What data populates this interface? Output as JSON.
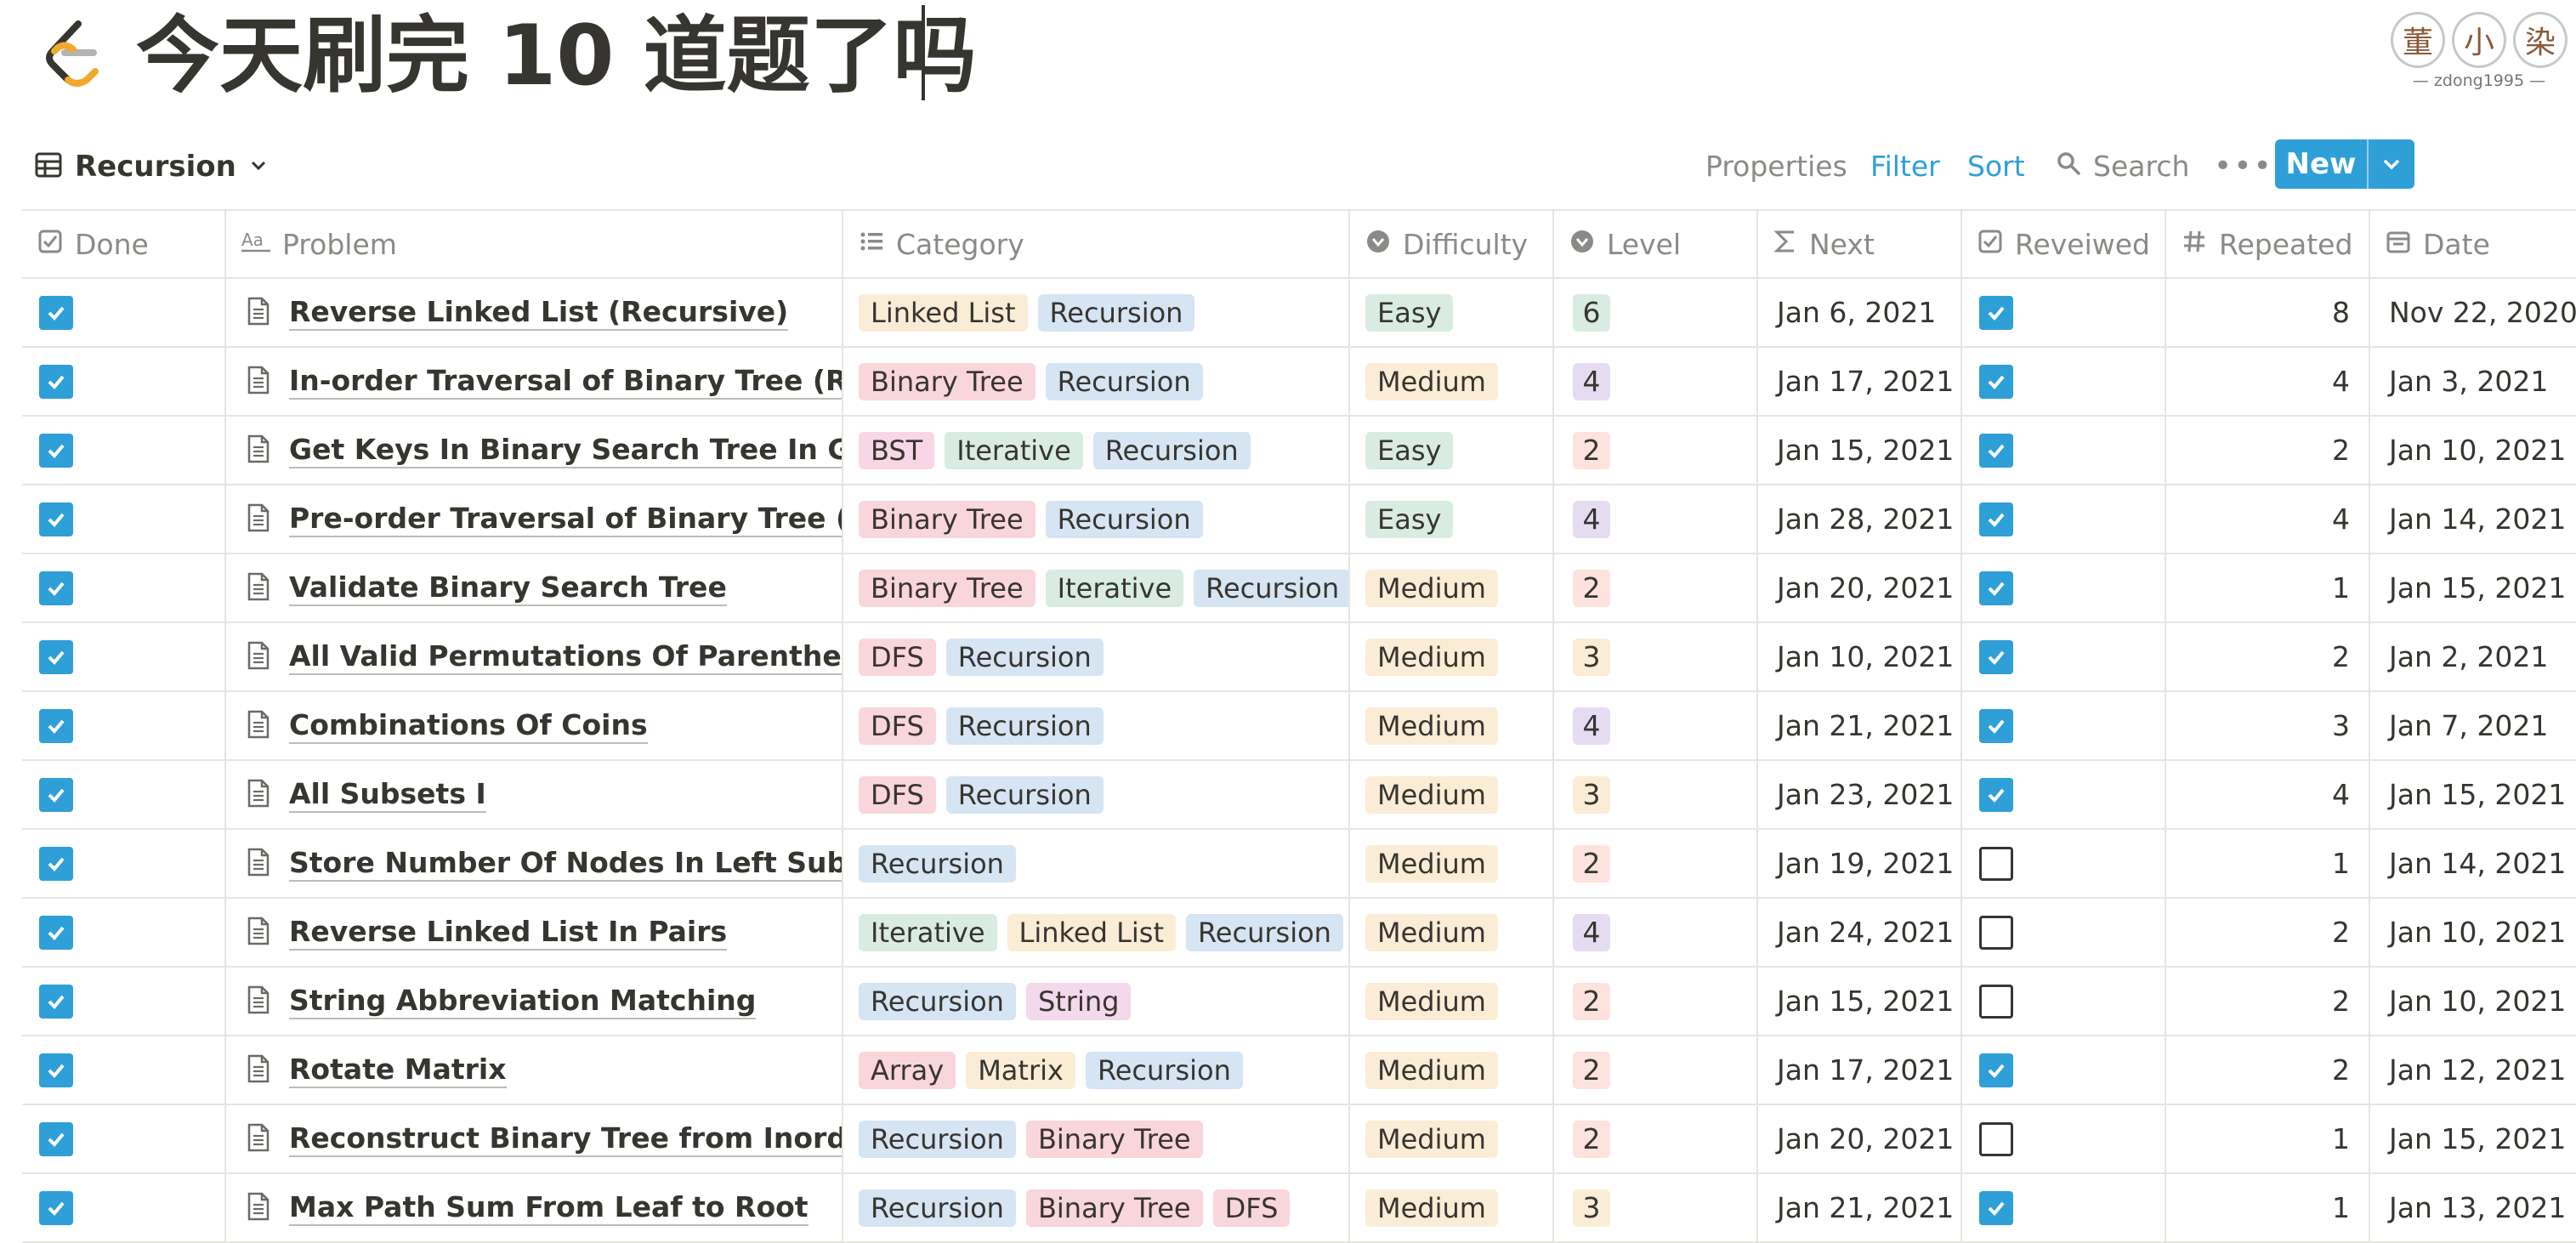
{
  "page": {
    "title": "今天刷完 10 道题了吗"
  },
  "watermark": {
    "stamps": [
      "董",
      "小",
      "染"
    ],
    "caption": "— zdong1995 —"
  },
  "toolbar": {
    "view_name": "Recursion",
    "properties": "Properties",
    "filter": "Filter",
    "sort": "Sort",
    "search": "Search",
    "more": "•••",
    "new_label": "New"
  },
  "columns": [
    "Done",
    "Problem",
    "Category",
    "Difficulty",
    "Level",
    "Next",
    "Reveiwed",
    "Repeated",
    "Date"
  ],
  "tag_colors": {
    "Linked List": "#fbecd6",
    "Recursion": "#d6e5f4",
    "Binary Tree": "#f9d6db",
    "BST": "#f9d6e6",
    "Iterative": "#d8ece2",
    "DFS": "#f9d6db",
    "String": "#f4d8ec",
    "Array": "#f9d6db",
    "Matrix": "#fbecd6"
  },
  "difficulty_colors": {
    "Easy": "#d8ece2",
    "Medium": "#fbecd6"
  },
  "level_colors": {
    "2": "#fde2dd",
    "3": "#fbecd6",
    "4": "#e6dcf2",
    "6": "#d8ece2"
  },
  "accent_color": "#2f9fd8",
  "rows": [
    {
      "done": true,
      "problem": "Reverse Linked List (Recursive)",
      "category": [
        "Linked List",
        "Recursion"
      ],
      "difficulty": "Easy",
      "level": "6",
      "next": "Jan 6, 2021",
      "reviewed": true,
      "repeated": "8",
      "date": "Nov 22, 2020"
    },
    {
      "done": true,
      "problem": "In-order Traversal of Binary Tree (Recursive)",
      "category": [
        "Binary Tree",
        "Recursion"
      ],
      "difficulty": "Medium",
      "level": "4",
      "next": "Jan 17, 2021",
      "reviewed": true,
      "repeated": "4",
      "date": "Jan 3, 2021"
    },
    {
      "done": true,
      "problem": "Get Keys In Binary Search Tree In Given Range",
      "category": [
        "BST",
        "Iterative",
        "Recursion"
      ],
      "difficulty": "Easy",
      "level": "2",
      "next": "Jan 15, 2021",
      "reviewed": true,
      "repeated": "2",
      "date": "Jan 10, 2021"
    },
    {
      "done": true,
      "problem": "Pre-order Traversal of Binary Tree (Recursive)",
      "category": [
        "Binary Tree",
        "Recursion"
      ],
      "difficulty": "Easy",
      "level": "4",
      "next": "Jan 28, 2021",
      "reviewed": true,
      "repeated": "4",
      "date": "Jan 14, 2021"
    },
    {
      "done": true,
      "problem": "Validate Binary Search Tree",
      "category": [
        "Binary Tree",
        "Iterative",
        "Recursion"
      ],
      "difficulty": "Medium",
      "level": "2",
      "next": "Jan 20, 2021",
      "reviewed": true,
      "repeated": "1",
      "date": "Jan 15, 2021"
    },
    {
      "done": true,
      "problem": "All Valid Permutations Of Parentheses I",
      "category": [
        "DFS",
        "Recursion"
      ],
      "difficulty": "Medium",
      "level": "3",
      "next": "Jan 10, 2021",
      "reviewed": true,
      "repeated": "2",
      "date": "Jan 2, 2021"
    },
    {
      "done": true,
      "problem": "Combinations Of Coins",
      "category": [
        "DFS",
        "Recursion"
      ],
      "difficulty": "Medium",
      "level": "4",
      "next": "Jan 21, 2021",
      "reviewed": true,
      "repeated": "3",
      "date": "Jan 7, 2021"
    },
    {
      "done": true,
      "problem": "All Subsets I",
      "category": [
        "DFS",
        "Recursion"
      ],
      "difficulty": "Medium",
      "level": "3",
      "next": "Jan 23, 2021",
      "reviewed": true,
      "repeated": "4",
      "date": "Jan 15, 2021"
    },
    {
      "done": true,
      "problem": "Store Number Of Nodes In Left Subtree",
      "category": [
        "Recursion"
      ],
      "difficulty": "Medium",
      "level": "2",
      "next": "Jan 19, 2021",
      "reviewed": false,
      "repeated": "1",
      "date": "Jan 14, 2021"
    },
    {
      "done": true,
      "problem": "Reverse Linked List In Pairs",
      "category": [
        "Iterative",
        "Linked List",
        "Recursion"
      ],
      "difficulty": "Medium",
      "level": "4",
      "next": "Jan 24, 2021",
      "reviewed": false,
      "repeated": "2",
      "date": "Jan 10, 2021"
    },
    {
      "done": true,
      "problem": "String Abbreviation Matching",
      "category": [
        "Recursion",
        "String"
      ],
      "difficulty": "Medium",
      "level": "2",
      "next": "Jan 15, 2021",
      "reviewed": false,
      "repeated": "2",
      "date": "Jan 10, 2021"
    },
    {
      "done": true,
      "problem": "Rotate Matrix",
      "category": [
        "Array",
        "Matrix",
        "Recursion"
      ],
      "difficulty": "Medium",
      "level": "2",
      "next": "Jan 17, 2021",
      "reviewed": true,
      "repeated": "2",
      "date": "Jan 12, 2021"
    },
    {
      "done": true,
      "problem": "Reconstruct Binary Tree from Inorder and Preorder",
      "category": [
        "Recursion",
        "Binary Tree"
      ],
      "difficulty": "Medium",
      "level": "2",
      "next": "Jan 20, 2021",
      "reviewed": false,
      "repeated": "1",
      "date": "Jan 15, 2021"
    },
    {
      "done": true,
      "problem": "Max Path Sum From Leaf to Root",
      "category": [
        "Recursion",
        "Binary Tree",
        "DFS"
      ],
      "difficulty": "Medium",
      "level": "3",
      "next": "Jan 21, 2021",
      "reviewed": true,
      "repeated": "1",
      "date": "Jan 13, 2021"
    }
  ]
}
